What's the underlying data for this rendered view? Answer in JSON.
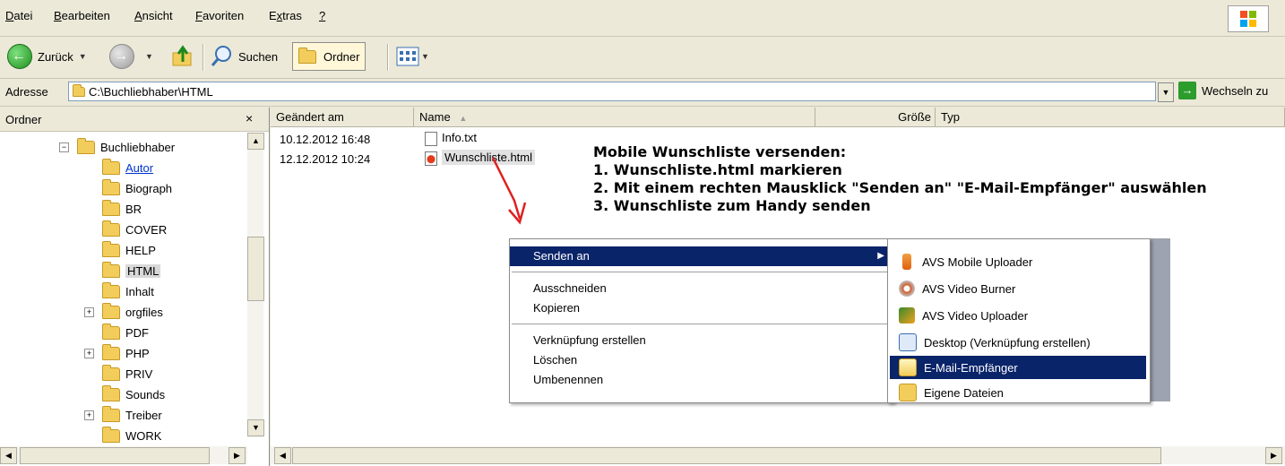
{
  "menubar": {
    "items": [
      "Datei",
      "Bearbeiten",
      "Ansicht",
      "Favoriten",
      "Extras",
      "?"
    ],
    "mnemonics": [
      "D",
      "B",
      "A",
      "F",
      "x",
      "?"
    ]
  },
  "toolbar": {
    "back_label": "Zurück",
    "search_label": "Suchen",
    "folders_label": "Ordner"
  },
  "address": {
    "label": "Adresse",
    "value": "C:\\Buchliebhaber\\HTML",
    "go_label": "Wechseln zu"
  },
  "folder_pane": {
    "title": "Ordner",
    "close_glyph": "×",
    "tree": [
      {
        "label": "Buchliebhaber",
        "expander": "−",
        "level": 0
      },
      {
        "label": "Autor",
        "expander": "",
        "level": 1,
        "style": "link"
      },
      {
        "label": "Biograph",
        "expander": "",
        "level": 1
      },
      {
        "label": "BR",
        "expander": "",
        "level": 1
      },
      {
        "label": "COVER",
        "expander": "",
        "level": 1
      },
      {
        "label": "HELP",
        "expander": "",
        "level": 1
      },
      {
        "label": "HTML",
        "expander": "",
        "level": 1,
        "style": "selected"
      },
      {
        "label": "Inhalt",
        "expander": "",
        "level": 1
      },
      {
        "label": "orgfiles",
        "expander": "+",
        "level": 1
      },
      {
        "label": "PDF",
        "expander": "",
        "level": 1
      },
      {
        "label": "PHP",
        "expander": "+",
        "level": 1
      },
      {
        "label": "PRIV",
        "expander": "",
        "level": 1
      },
      {
        "label": "Sounds",
        "expander": "",
        "level": 1
      },
      {
        "label": "Treiber",
        "expander": "+",
        "level": 1
      },
      {
        "label": "WORK",
        "expander": "",
        "level": 1
      }
    ]
  },
  "file_list": {
    "columns": [
      "Geändert am",
      "Name",
      "Größe",
      "Typ"
    ],
    "rows": [
      {
        "modified": "10.12.2012 16:48",
        "name": "Info.txt",
        "icon": "text-file-icon"
      },
      {
        "modified": "12.12.2012 10:24",
        "name": "Wunschliste.html",
        "icon": "html-file-icon",
        "selected": true
      }
    ]
  },
  "instructions": {
    "title": "Mobile Wunschliste versenden:",
    "steps": [
      "1. Wunschliste.html markieren",
      "2. Mit einem rechten Mausklick \"Senden an\" \"E-Mail-Empfänger\" auswählen",
      "3. Wunschliste zum Handy senden"
    ]
  },
  "context_menu": {
    "items": [
      {
        "label": "Senden an",
        "highlighted": true,
        "submenu": true
      },
      {
        "label": "Ausschneiden"
      },
      {
        "label": "Kopieren"
      },
      {
        "label": "Verknüpfung erstellen"
      },
      {
        "label": "Löschen"
      },
      {
        "label": "Umbenennen"
      }
    ]
  },
  "send_to_menu": {
    "items": [
      {
        "label": "AVS Mobile Uploader",
        "icon": "upload-arrow-icon"
      },
      {
        "label": "AVS Video Burner",
        "icon": "disc-icon"
      },
      {
        "label": "AVS Video Uploader",
        "icon": "film-icon"
      },
      {
        "label": "Desktop (Verknüpfung erstellen)",
        "icon": "desktop-shortcut-icon"
      },
      {
        "label": "E-Mail-Empfänger",
        "icon": "mail-icon",
        "highlighted": true
      },
      {
        "label": "Eigene Dateien",
        "icon": "documents-folder-icon"
      }
    ]
  },
  "colors": {
    "highlight": "#0a246a",
    "chrome": "#ece9d8",
    "annotation_arrow": "#e02020"
  }
}
